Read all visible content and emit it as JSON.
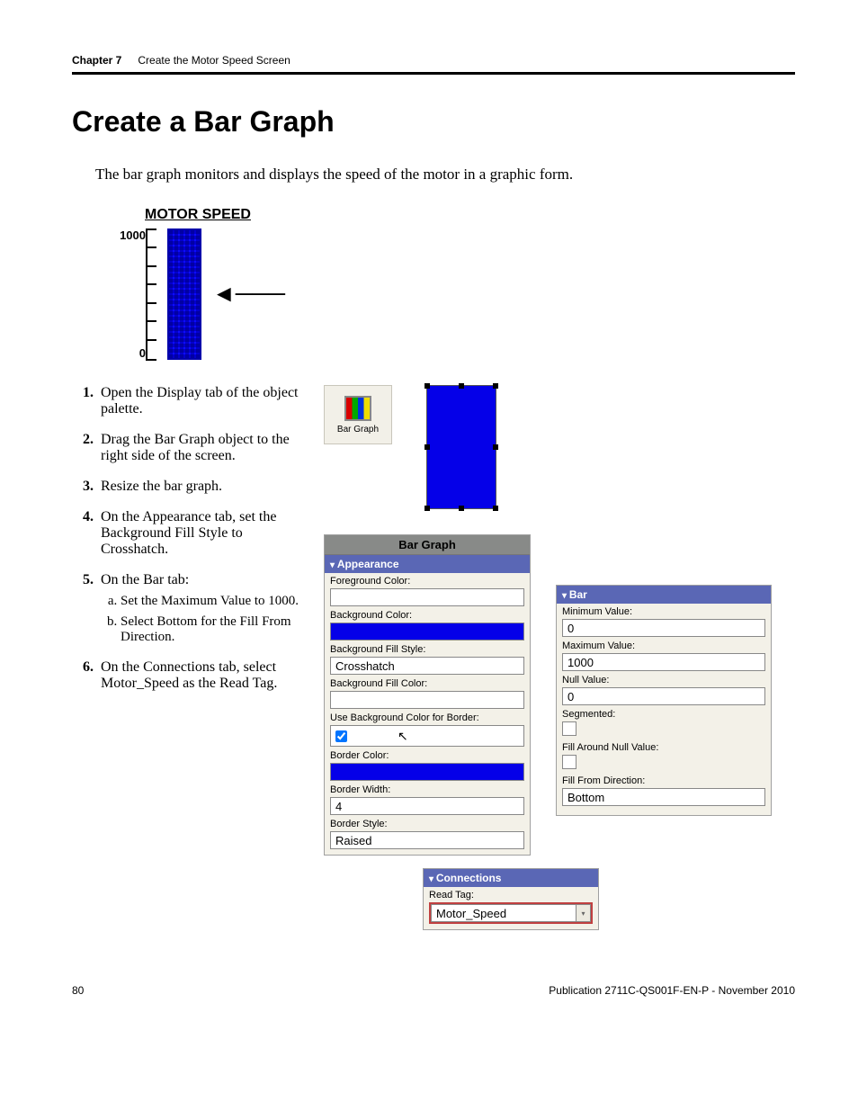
{
  "header": {
    "chapter": "Chapter 7",
    "title": "Create the Motor Speed Screen"
  },
  "section_title": "Create a Bar Graph",
  "intro": "The bar graph monitors and displays the speed of the motor in a graphic form.",
  "bargraph_demo": {
    "title": "MOTOR SPEED",
    "max_label": "1000",
    "min_label": "0"
  },
  "chart_data": {
    "type": "bar",
    "title": "MOTOR SPEED",
    "categories": [
      "Motor Speed"
    ],
    "values": [
      1000
    ],
    "ylim": [
      0,
      1000
    ],
    "xlabel": "",
    "ylabel": ""
  },
  "steps": {
    "s1": "Open the Display tab of the object palette.",
    "s2": "Drag the Bar Graph object to the right side of the screen.",
    "s3": "Resize the bar graph.",
    "s4": "On the Appearance tab, set the Background Fill Style to Crosshatch.",
    "s5": "On the Bar tab:",
    "s5a": "Set the Maximum Value to 1000.",
    "s5b": "Select Bottom for the Fill From Direction.",
    "s6": "On the Connections tab, select Motor_Speed as the Read Tag."
  },
  "palette_icon_label": "Bar Graph",
  "appearance_panel": {
    "title": "Bar Graph",
    "section": "Appearance",
    "fields": {
      "foreground_color": "Foreground Color:",
      "background_color": "Background Color:",
      "background_fill_style_label": "Background Fill Style:",
      "background_fill_style_value": "Crosshatch",
      "background_fill_color": "Background Fill Color:",
      "use_bg_for_border": "Use Background Color for Border:",
      "border_color": "Border Color:",
      "border_width_label": "Border Width:",
      "border_width_value": "4",
      "border_style_label": "Border Style:",
      "border_style_value": "Raised"
    }
  },
  "bar_panel": {
    "section": "Bar",
    "fields": {
      "min_label": "Minimum Value:",
      "min_value": "0",
      "max_label": "Maximum Value:",
      "max_value": "1000",
      "null_label": "Null Value:",
      "null_value": "0",
      "segmented_label": "Segmented:",
      "fill_around_label": "Fill Around Null Value:",
      "fill_from_label": "Fill From Direction:",
      "fill_from_value": "Bottom"
    }
  },
  "connections_panel": {
    "section": "Connections",
    "read_tag_label": "Read Tag:",
    "read_tag_value": "Motor_Speed"
  },
  "footer": {
    "page": "80",
    "pub": "Publication 2711C-QS001F-EN-P - November 2010"
  }
}
